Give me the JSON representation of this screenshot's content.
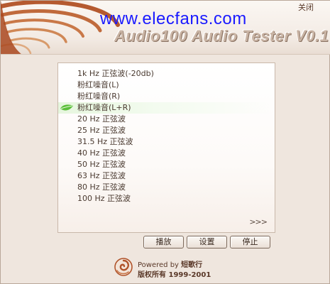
{
  "header": {
    "watermark": "www.elecfans.com",
    "product_title": "Audio100 Audio Tester V0.1",
    "close_label": "关闭"
  },
  "list": {
    "items": [
      "1k Hz 正弦波(-20db)",
      "粉红噪音(L)",
      "粉红噪音(R)",
      "粉红噪音(L+R)",
      "20 Hz 正弦波",
      "25 Hz 正弦波",
      "31.5 Hz 正弦波",
      "40 Hz 正弦波",
      "50 Hz 正弦波",
      "63 Hz 正弦波",
      "80 Hz 正弦波",
      "100 Hz 正弦波"
    ],
    "selected_index": 3,
    "more_label": ">>>"
  },
  "buttons": {
    "play": "播放",
    "settings": "设置",
    "stop": "停止"
  },
  "footer": {
    "powered_prefix": "Powered by",
    "powered_brand": "短歌行",
    "copyright": "版权所有 1999-2001"
  },
  "colors": {
    "accent": "#b0532a",
    "background": "#efe6de",
    "selection": "#e6f6de",
    "watermark": "#1a1aff"
  }
}
